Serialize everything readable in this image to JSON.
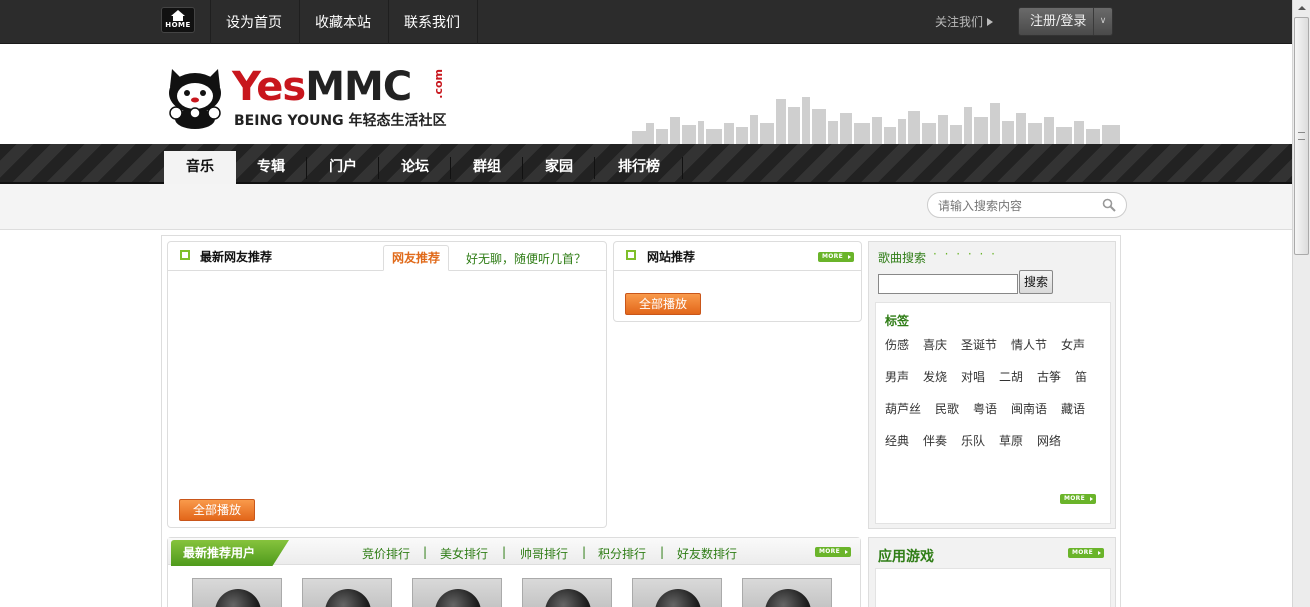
{
  "topbar": {
    "home_label": "HOME",
    "links": [
      "设为首页",
      "收藏本站",
      "联系我们"
    ],
    "follow_label": "关注我们",
    "login_label": "注册/登录"
  },
  "header": {
    "brand_yes": "Yes",
    "brand_mmc": "MMC",
    "brand_com": ".com",
    "tagline": "BEING YOUNG 年轻态生活社区"
  },
  "nav": {
    "items": [
      "音乐",
      "专辑",
      "门户",
      "论坛",
      "群组",
      "家园",
      "排行榜"
    ],
    "active_index": 0
  },
  "search": {
    "placeholder": "请输入搜索内容"
  },
  "friend_box": {
    "title": "最新网友推荐",
    "tab_active": "网友推荐",
    "tab_other": "好无聊，随便听几首？",
    "play_all": "全部播放"
  },
  "site_box": {
    "title": "网站推荐",
    "more": "MORE",
    "play_all": "全部播放"
  },
  "song_search": {
    "label": "歌曲搜索",
    "dots": "· · · · · ·",
    "button": "搜索",
    "value": ""
  },
  "tags": {
    "title": "标签",
    "rows": [
      [
        "伤感",
        "喜庆",
        "圣诞节",
        "情人节",
        "女声"
      ],
      [
        "男声",
        "发烧",
        "对唱",
        "二胡",
        "古筝",
        "笛"
      ],
      [
        "葫芦丝",
        "民歌",
        "粤语",
        "闽南语",
        "藏语"
      ],
      [
        "经典",
        "伴奏",
        "乐队",
        "草原",
        "网络"
      ]
    ],
    "more": "MORE"
  },
  "rank_box": {
    "title": "最新推荐用户",
    "links": [
      "竞价排行",
      "美女排行",
      "帅哥排行",
      "积分排行",
      "好友数排行"
    ],
    "separator": "|",
    "more": "MORE"
  },
  "app_box": {
    "title": "应用游戏",
    "more": "MORE"
  }
}
